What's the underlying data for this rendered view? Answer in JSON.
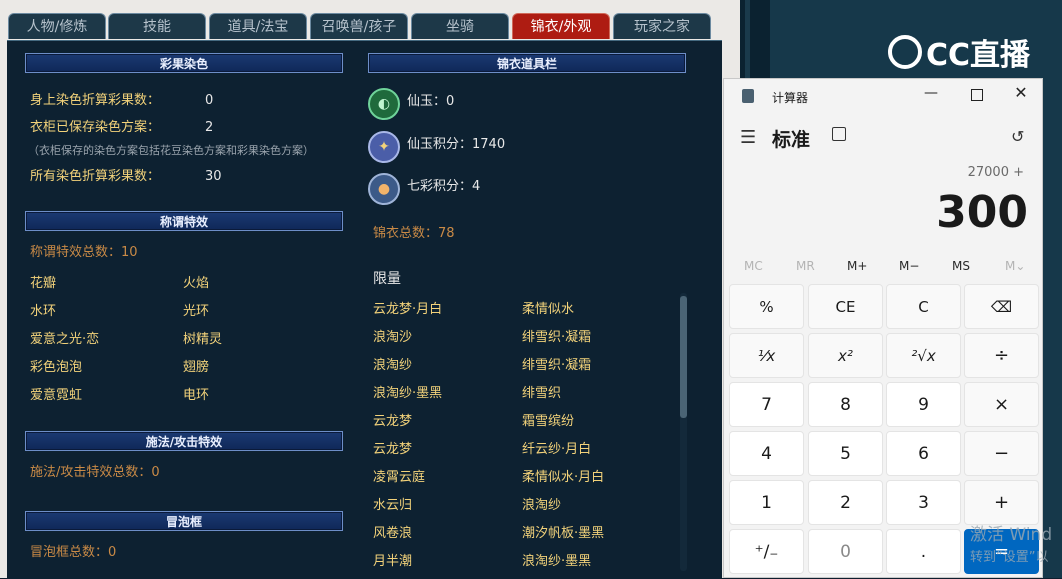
{
  "tabs": [
    "人物/修炼",
    "技能",
    "道具/法宝",
    "召唤兽/孩子",
    "坐骑",
    "锦衣/外观",
    "玩家之家"
  ],
  "dye": {
    "header": "彩果染色",
    "body_label": "身上染色折算彩果数：",
    "body_value": "0",
    "wardrobe_label": "衣柜已保存染色方案：",
    "wardrobe_value": "2",
    "note": "（衣柜保存的染色方案包括花豆染色方案和彩果染色方案）",
    "all_label": "所有染色折算彩果数：",
    "all_value": "30"
  },
  "title_effects": {
    "header": "称谓特效",
    "total": "称谓特效总数：10",
    "items": [
      "花瓣",
      "火焰",
      "水环",
      "光环",
      "爱意之光·恋",
      "树精灵",
      "彩色泡泡",
      "翅膀",
      "爱意霓虹",
      "电环"
    ]
  },
  "cast_effects": {
    "header": "施法/攻击特效",
    "total": "施法/攻击特效总数：0"
  },
  "bubble": {
    "header": "冒泡框",
    "total": "冒泡框总数：0"
  },
  "costume_bar": {
    "header": "锦衣道具栏",
    "xianyu": "仙玉：0",
    "xianyu_points": "仙玉积分：1740",
    "qicai_points": "七彩积分：4",
    "total": "锦衣总数：78",
    "limited_label": "限量",
    "limited_items": [
      "云龙梦·月白",
      "柔情似水",
      "浪淘沙",
      "绯雪织·凝霜",
      "浪淘纱",
      "绯雪织·凝霜",
      "浪淘纱·墨黑",
      "绯雪织",
      "云龙梦",
      "霜雪缤纷",
      "云龙梦",
      "纤云纱·月白",
      "凌霄云庭",
      "柔情似水·月白",
      "水云归",
      "浪淘纱",
      "风卷浪",
      "潮汐帆板·墨黑",
      "月半潮",
      "浪淘纱·墨黑"
    ]
  },
  "calculator": {
    "title": "计算器",
    "mode": "标准",
    "expression": "27000 +",
    "display": "300",
    "memory": [
      "MC",
      "MR",
      "M+",
      "M−",
      "MS",
      "M⌄"
    ],
    "buttons": [
      "%",
      "CE",
      "C",
      "⌫",
      "⅟x",
      "x²",
      "²√x",
      "÷",
      "7",
      "8",
      "9",
      "×",
      "4",
      "5",
      "6",
      "−",
      "1",
      "2",
      "3",
      "+",
      "⁺∕₋",
      "0",
      ".",
      "="
    ]
  },
  "stream_logo": "CC直播",
  "watermark": {
    "line1": "激活 Wind",
    "line2": "转到“设置”以"
  },
  "colors": {
    "active_tab": "#ae1c12",
    "panel_bg": "#0d2131",
    "accent_blue": "#0067c0",
    "gold_text": "#f2d27a",
    "orange_text": "#c98a46"
  }
}
